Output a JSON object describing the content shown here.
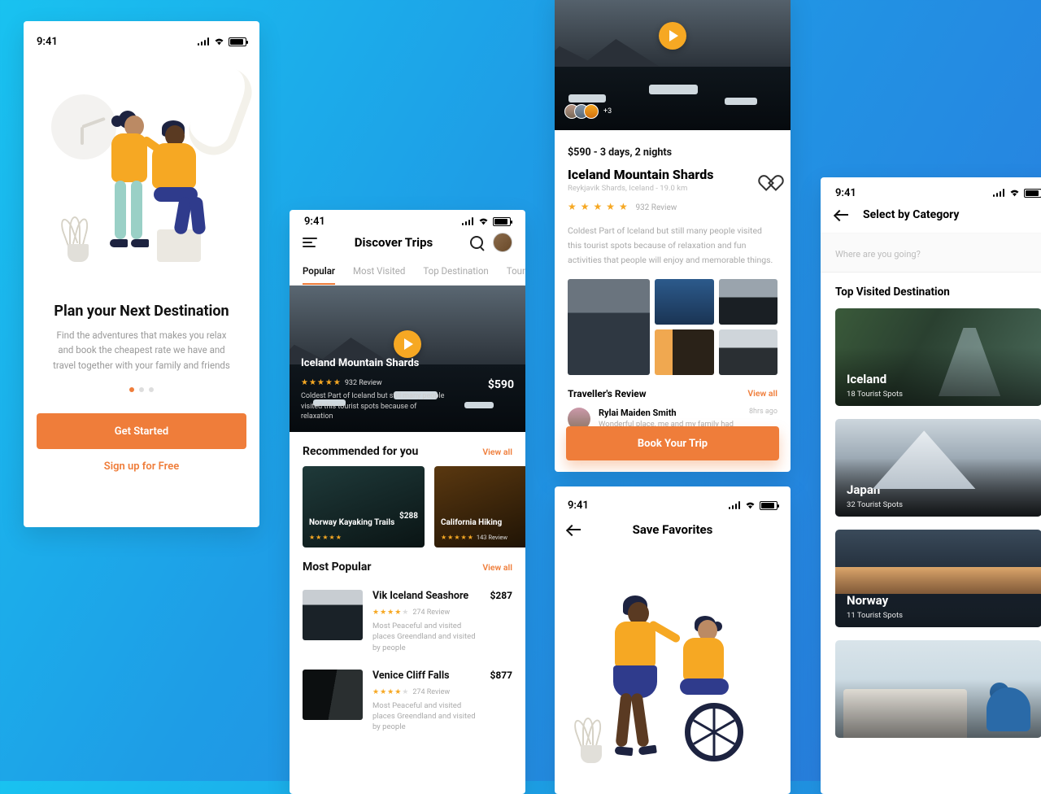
{
  "statusbar": {
    "time": "9:41"
  },
  "onboarding": {
    "title": "Plan your Next Destination",
    "subtitle": "Find the adventures that makes you relax and book the cheapest rate we have and travel together with your family and friends",
    "cta": "Get Started",
    "signup": "Sign up for Free"
  },
  "discover": {
    "title": "Discover Trips",
    "tabs": [
      "Popular",
      "Most Visited",
      "Top Destination",
      "Tourist Spots"
    ],
    "hero": {
      "title": "Iceland Mountain Shards",
      "reviews": "932 Review",
      "desc": "Coldest Part of Iceland but still many people visited this tourist spots because of relaxation",
      "price": "$590"
    },
    "recommended_title": "Recommended for you",
    "view_all": "View all",
    "cards": [
      {
        "title": "Norway Kayaking Trails",
        "price": "$288",
        "reviews": ""
      },
      {
        "title": "California Hiking",
        "price": "",
        "reviews": "143 Review"
      }
    ],
    "popular_title": "Most Popular",
    "list": [
      {
        "title": "Vik Iceland Seashore",
        "reviews": "274 Review",
        "desc": "Most Peaceful and visited places Greendland and visited by people",
        "price": "$287"
      },
      {
        "title": "Venice Cliff Falls",
        "reviews": "274 Review",
        "desc": "Most Peaceful and visited places Greendland and visited by people",
        "price": "$877"
      }
    ]
  },
  "detail": {
    "avatars_more": "+3",
    "meta": "$590 - 3 days, 2 nights",
    "title": "Iceland Mountain Shards",
    "location": "Reykjavik Shards, Iceland - 19.0 km",
    "reviews": "932 Review",
    "desc": "Coldest Part of Iceland but still many people visited this tourist spots because of relaxation and fun activities that people will enjoy and memorable things.",
    "reviews_title": "Traveller's Review",
    "view_all": "View all",
    "review": {
      "name": "Rylai Maiden Smith",
      "text": "Wonderful place, me and my family had",
      "time": "8hrs ago"
    },
    "book": "Book Your Trip"
  },
  "favorites": {
    "title": "Save Favorites"
  },
  "category": {
    "title": "Select by Category",
    "placeholder": "Where are you going?",
    "section": "Top Visited Destination",
    "items": [
      {
        "name": "Iceland",
        "spots": "18 Tourist Spots"
      },
      {
        "name": "Japan",
        "spots": "32 Tourist Spots"
      },
      {
        "name": "Norway",
        "spots": "11 Tourist Spots"
      },
      {
        "name": "",
        "spots": ""
      }
    ]
  }
}
